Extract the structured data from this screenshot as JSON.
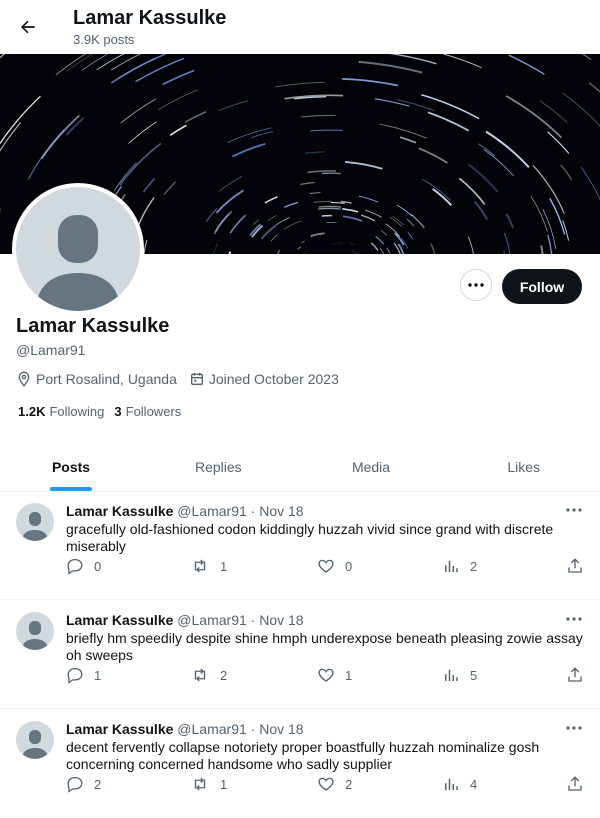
{
  "header": {
    "title": "Lamar Kassulke",
    "post_count": "3.9K posts"
  },
  "profile": {
    "name": "Lamar Kassulke",
    "handle": "@Lamar91",
    "location": "Port Rosalind, Uganda",
    "joined": "Joined October 2023",
    "following_count": "1.2K",
    "following_label": "Following",
    "followers_count": "3",
    "followers_label": "Followers",
    "follow_label": "Follow"
  },
  "tabs": [
    "Posts",
    "Replies",
    "Media",
    "Likes"
  ],
  "active_tab": "Posts",
  "posts": [
    {
      "name": "Lamar Kassulke",
      "handle": "@Lamar91",
      "sep": "·",
      "date": "Nov 18",
      "text": "gracefully old-fashioned codon kiddingly huzzah vivid since grand with discrete miserably",
      "replies": "0",
      "reposts": "1",
      "likes": "0",
      "views": "2"
    },
    {
      "name": "Lamar Kassulke",
      "handle": "@Lamar91",
      "sep": "·",
      "date": "Nov 18",
      "text": "briefly hm speedily despite shine hmph underexpose beneath pleasing zowie assay oh sweeps",
      "replies": "1",
      "reposts": "2",
      "likes": "1",
      "views": "5"
    },
    {
      "name": "Lamar Kassulke",
      "handle": "@Lamar91",
      "sep": "·",
      "date": "Nov 18",
      "text": "decent fervently collapse notoriety proper boastfully huzzah nominalize gosh concerning concerned handsome who sadly supplier",
      "replies": "2",
      "reposts": "1",
      "likes": "2",
      "views": "4"
    }
  ],
  "colors": {
    "accent": "#1d9bf0",
    "text": "#0f1419",
    "muted": "#536471",
    "follow_bg": "#0f1419"
  }
}
